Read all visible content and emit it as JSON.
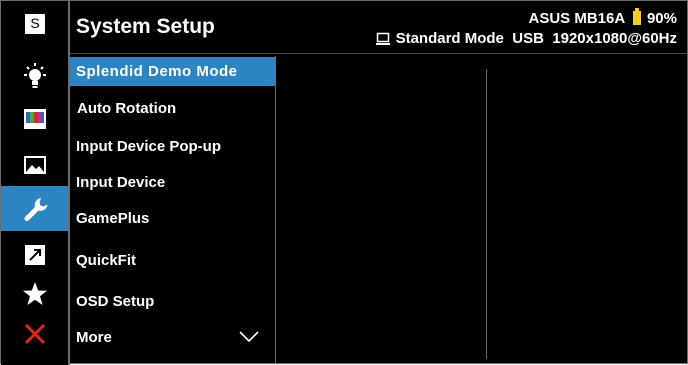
{
  "header": {
    "title": "System Setup",
    "model": "ASUS MB16A",
    "battery": "90%",
    "mode": "Standard Mode",
    "input": "USB",
    "resolution": "1920x1080@60Hz"
  },
  "sidebar": {
    "items": [
      {
        "name": "splendid",
        "icon": "s-icon"
      },
      {
        "name": "blue-light-filter",
        "icon": "light-bulb-icon"
      },
      {
        "name": "color",
        "icon": "color-bars-icon"
      },
      {
        "name": "image",
        "icon": "image-icon"
      },
      {
        "name": "system-setup",
        "icon": "wrench-icon",
        "active": true
      },
      {
        "name": "shortcut",
        "icon": "shortcut-arrow-icon"
      },
      {
        "name": "favorites",
        "icon": "star-icon"
      },
      {
        "name": "exit",
        "icon": "close-icon"
      }
    ],
    "s_label": "S"
  },
  "menu": {
    "items": [
      "Splendid Demo Mode",
      "Auto Rotation",
      "Input Device Pop-up",
      "Input Device",
      "GamePlus",
      "QuickFit",
      "OSD Setup",
      "More"
    ],
    "selected_index": 0
  },
  "colors": {
    "accent": "#2d84c3",
    "background": "#000000",
    "battery": "#f3d21b",
    "exit": "#e52420",
    "divider": "#6d6d6d"
  }
}
